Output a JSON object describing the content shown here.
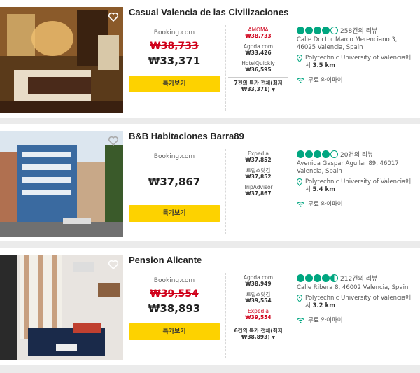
{
  "hotels": [
    {
      "name": "Casual Valencia de las Civilizaciones",
      "provider": "Booking.com",
      "old_price": "₩38,733",
      "price": "₩33,371",
      "deal_button": "특가보기",
      "others": [
        {
          "name": "AMOMA",
          "price": "₩38,733",
          "red": true
        },
        {
          "name": "Agoda.com",
          "price": "₩33,426",
          "red": false
        },
        {
          "name": "HotelQuickly",
          "price": "₩36,595",
          "red": false
        }
      ],
      "all_deals": "7건의 특가 전체(최저",
      "all_deals_price": "₩33,371)",
      "rating": 4,
      "reviews": "258건의 리뷰",
      "address": "Calle Doctor Marco Merenciano 3, 46025 Valencia, Spain",
      "landmark": "Polytechnic University of Valencia에서",
      "distance": "3.5 km",
      "amenity": "무료 와이파이"
    },
    {
      "name": "B&B Habitaciones Barra89",
      "provider": "Booking.com",
      "price": "₩37,867",
      "deal_button": "특가보기",
      "others": [
        {
          "name": "Expedia",
          "price": "₩37,852",
          "red": false
        },
        {
          "name": "트립스닷컴",
          "price": "₩37,852",
          "red": false
        },
        {
          "name": "TripAdvisor",
          "price": "₩37,867",
          "red": false
        }
      ],
      "rating": 4,
      "reviews": "20건의 리뷰",
      "address": "Avenida Gaspar Aguilar 89, 46017 Valencia, Spain",
      "landmark": "Polytechnic University of Valencia에서",
      "distance": "5.4 km",
      "amenity": "무료 와이파이"
    },
    {
      "name": "Pension Alicante",
      "provider": "Booking.com",
      "old_price": "₩39,554",
      "price": "₩38,893",
      "deal_button": "특가보기",
      "others": [
        {
          "name": "Agoda.com",
          "price": "₩38,949",
          "red": false
        },
        {
          "name": "트립스닷컴",
          "price": "₩39,554",
          "red": false
        },
        {
          "name": "Expedia",
          "price": "₩39,554",
          "red": true
        }
      ],
      "all_deals": "6건의 특가 전체(최저",
      "all_deals_price": "₩38,893)",
      "rating": 4.5,
      "reviews": "212건의 리뷰",
      "address": "Calle Ribera 8, 46002 Valencia, Spain",
      "landmark": "Polytechnic University of Valencia에서",
      "distance": "3.2 km",
      "amenity": "무료 와이파이"
    }
  ],
  "colors": {
    "deal_button": "#fdd200",
    "rating_green": "#00a680",
    "strike_red": "#d0021b"
  },
  "icons": [
    "heart-icon",
    "map-pin-icon",
    "wifi-icon",
    "chevron-down-icon"
  ]
}
